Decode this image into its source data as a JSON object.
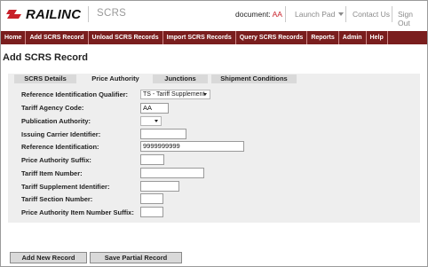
{
  "header": {
    "logo_text": "RAILINC",
    "app_name": "SCRS",
    "document_label": "document:",
    "document_value": "AA",
    "launch_pad": "Launch Pad",
    "contact_us": "Contact Us",
    "sign_out": "Sign Out",
    "brand_color": "#c8202a"
  },
  "nav": {
    "items": [
      "Home",
      "Add SCRS Record",
      "Unload SCRS Records",
      "Import SCRS Records",
      "Query SCRS Records",
      "Reports",
      "Admin",
      "Help"
    ],
    "background": "#7a1e1e"
  },
  "page_title": "Add SCRS Record",
  "tabs": [
    {
      "label": "SCRS Details",
      "active": false
    },
    {
      "label": "Price Authority",
      "active": true
    },
    {
      "label": "Junctions",
      "active": false
    },
    {
      "label": "Shipment Conditions",
      "active": false
    }
  ],
  "form": {
    "ref_id_qualifier_label": "Reference Identification Qualifier:",
    "ref_id_qualifier_value": "TS - Tariff Supplement",
    "tariff_agency_code_label": "Tariff Agency Code:",
    "tariff_agency_code_value": "AA",
    "publication_authority_label": "Publication Authority:",
    "publication_authority_value": "",
    "issuing_carrier_label": "Issuing Carrier Identifier:",
    "issuing_carrier_value": "",
    "reference_identification_label": "Reference Identification:",
    "reference_identification_value": "9999999999",
    "price_authority_suffix_label": "Price Authority Suffix:",
    "price_authority_suffix_value": "",
    "tariff_item_number_label": "Tariff Item Number:",
    "tariff_item_number_value": "",
    "tariff_supplement_id_label": "Tariff Supplement Identifier:",
    "tariff_supplement_id_value": "",
    "tariff_section_number_label": "Tariff Section Number:",
    "tariff_section_number_value": "",
    "price_authority_item_suffix_label": "Price Authority Item Number Suffix:",
    "price_authority_item_suffix_value": ""
  },
  "buttons": {
    "add_new_record": "Add New Record",
    "save_partial_record": "Save Partial Record"
  }
}
